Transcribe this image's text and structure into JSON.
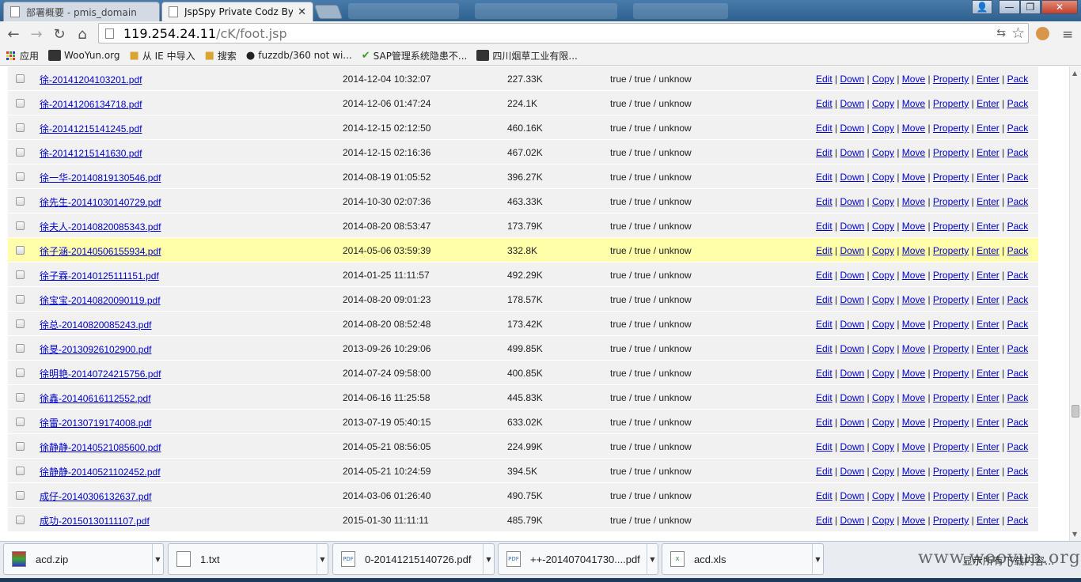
{
  "tabs": [
    {
      "label": "部署概要 - pmis_domain",
      "active": false
    },
    {
      "label": "JspSpy Private Codz By",
      "active": true
    }
  ],
  "window_controls": {
    "user": "👤",
    "minimize": "—",
    "maximize": "❐",
    "close": "✕"
  },
  "toolbar": {
    "back": "←",
    "forward": "→",
    "reload": "↻",
    "home": "⌂",
    "url_host": "119.254.24.11",
    "url_path": "/cK/foot.jsp",
    "translate": "⇆",
    "star": "☆",
    "menu": "≡"
  },
  "bookmarks": [
    {
      "label": "应用",
      "icon": "apps-icon"
    },
    {
      "label": "WooYun.org",
      "icon": "wooyun-icon"
    },
    {
      "label": "从 IE 中导入",
      "icon": "folder-icon"
    },
    {
      "label": "搜索",
      "icon": "folder-icon"
    },
    {
      "label": "fuzzdb/360 not wi...",
      "icon": "github-icon"
    },
    {
      "label": "SAP管理系统隐患不...",
      "icon": "check-icon"
    },
    {
      "label": "四川烟草工业有限...",
      "icon": "wooyun-icon"
    }
  ],
  "actions": [
    "Edit",
    "Down",
    "Copy",
    "Move",
    "Property",
    "Enter",
    "Pack"
  ],
  "files": [
    {
      "name": "徐-20141204103201.pdf",
      "date": "2014-12-04 10:32:07",
      "size": "227.33K",
      "perm": "true / true / unknow"
    },
    {
      "name": "徐-20141206134718.pdf",
      "date": "2014-12-06 01:47:24",
      "size": "224.1K",
      "perm": "true / true / unknow"
    },
    {
      "name": "徐-20141215141245.pdf",
      "date": "2014-12-15 02:12:50",
      "size": "460.16K",
      "perm": "true / true / unknow"
    },
    {
      "name": "徐-20141215141630.pdf",
      "date": "2014-12-15 02:16:36",
      "size": "467.02K",
      "perm": "true / true / unknow"
    },
    {
      "name": "徐一华-20140819130546.pdf",
      "date": "2014-08-19 01:05:52",
      "size": "396.27K",
      "perm": "true / true / unknow"
    },
    {
      "name": "徐先生-20141030140729.pdf",
      "date": "2014-10-30 02:07:36",
      "size": "463.33K",
      "perm": "true / true / unknow"
    },
    {
      "name": "徐夫人-20140820085343.pdf",
      "date": "2014-08-20 08:53:47",
      "size": "173.79K",
      "perm": "true / true / unknow"
    },
    {
      "name": "徐子涵-20140506155934.pdf",
      "date": "2014-05-06 03:59:39",
      "size": "332.8K",
      "perm": "true / true / unknow",
      "highlight": true
    },
    {
      "name": "徐子霖-20140125111151.pdf",
      "date": "2014-01-25 11:11:57",
      "size": "492.29K",
      "perm": "true / true / unknow"
    },
    {
      "name": "徐宝宝-20140820090119.pdf",
      "date": "2014-08-20 09:01:23",
      "size": "178.57K",
      "perm": "true / true / unknow"
    },
    {
      "name": "徐总-20140820085243.pdf",
      "date": "2014-08-20 08:52:48",
      "size": "173.42K",
      "perm": "true / true / unknow"
    },
    {
      "name": "徐旻-20130926102900.pdf",
      "date": "2013-09-26 10:29:06",
      "size": "499.85K",
      "perm": "true / true / unknow"
    },
    {
      "name": "徐明艳-20140724215756.pdf",
      "date": "2014-07-24 09:58:00",
      "size": "400.85K",
      "perm": "true / true / unknow"
    },
    {
      "name": "徐鑫-20140616112552.pdf",
      "date": "2014-06-16 11:25:58",
      "size": "445.83K",
      "perm": "true / true / unknow"
    },
    {
      "name": "徐雷-20130719174008.pdf",
      "date": "2013-07-19 05:40:15",
      "size": "633.02K",
      "perm": "true / true / unknow"
    },
    {
      "name": "徐静静-20140521085600.pdf",
      "date": "2014-05-21 08:56:05",
      "size": "224.99K",
      "perm": "true / true / unknow"
    },
    {
      "name": "徐静静-20140521102452.pdf",
      "date": "2014-05-21 10:24:59",
      "size": "394.5K",
      "perm": "true / true / unknow"
    },
    {
      "name": "成仔-20140306132637.pdf",
      "date": "2014-03-06 01:26:40",
      "size": "490.75K",
      "perm": "true / true / unknow"
    },
    {
      "name": "成功-20150130111107.pdf",
      "date": "2015-01-30 11:11:11",
      "size": "485.79K",
      "perm": "true / true / unknow"
    }
  ],
  "downloads": [
    {
      "name": "acd.zip",
      "icon": "zip-icon"
    },
    {
      "name": "1.txt",
      "icon": "txt-icon"
    },
    {
      "name": "0-20141215140726.pdf",
      "icon": "pdf-icon"
    },
    {
      "name": "++-201407041730....pdf",
      "icon": "pdf-icon"
    },
    {
      "name": "acd.xls",
      "icon": "xls-icon"
    }
  ],
  "show_all_downloads": "显示所有下载内容...",
  "watermark": "www.wooyun.org"
}
